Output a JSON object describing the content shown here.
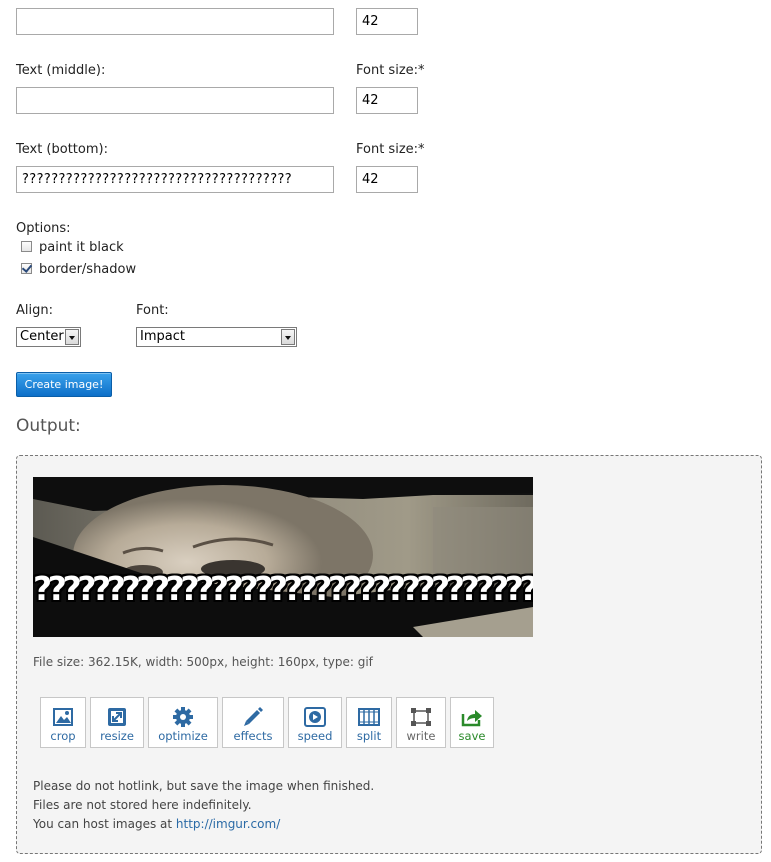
{
  "text_top": {
    "value": "",
    "font_size": "42"
  },
  "text_middle": {
    "label": "Text (middle):",
    "value": "",
    "font_size_label": "Font size:*",
    "font_size": "42"
  },
  "text_bottom": {
    "label": "Text (bottom):",
    "value": "?????????????????????????????????????",
    "font_size_label": "Font size:*",
    "font_size": "42"
  },
  "options": {
    "label": "Options:",
    "items": [
      {
        "label": "paint it black",
        "checked": false
      },
      {
        "label": "border/shadow",
        "checked": true
      }
    ]
  },
  "align": {
    "label": "Align:",
    "selected": "Center"
  },
  "font": {
    "label": "Font:",
    "selected": "Impact"
  },
  "create_button": "Create image!",
  "output": {
    "title": "Output:",
    "meme_text": "???????????????????????????????????????",
    "file_info": "File size: 362.15K, width: 500px, height: 160px, type: gif",
    "tools": [
      {
        "label": "crop",
        "icon": "crop-icon"
      },
      {
        "label": "resize",
        "icon": "resize-icon"
      },
      {
        "label": "optimize",
        "icon": "gear-icon"
      },
      {
        "label": "effects",
        "icon": "pencil-icon"
      },
      {
        "label": "speed",
        "icon": "play-icon"
      },
      {
        "label": "split",
        "icon": "film-icon"
      },
      {
        "label": "write",
        "icon": "text-frame-icon"
      },
      {
        "label": "save",
        "icon": "save-arrow-icon"
      }
    ],
    "notes": [
      "Please do not hotlink, but save the image when finished.",
      "Files are not stored here indefinitely."
    ],
    "host_prefix": "You can host images at ",
    "host_link": "http://imgur.com/"
  },
  "colors": {
    "accent_blue": "#0d6fc8",
    "link_blue": "#2e6aa3",
    "save_green": "#2a8a2a"
  }
}
